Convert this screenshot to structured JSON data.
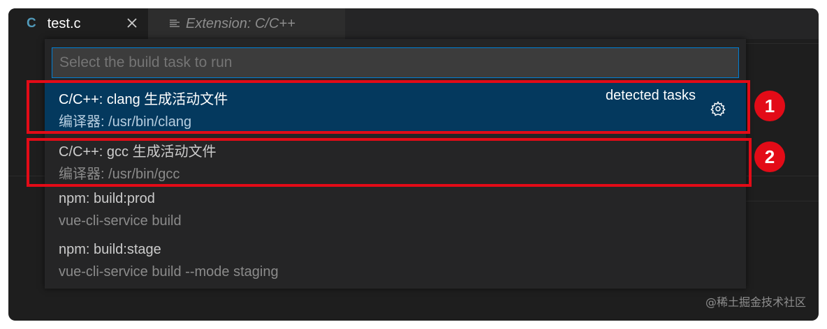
{
  "tabs": {
    "active": {
      "icon": "c-language-icon",
      "icon_text": "C",
      "label": "test.c"
    },
    "inactive": {
      "icon": "preview-icon",
      "label": "Extension: C/C++"
    }
  },
  "quick_pick": {
    "placeholder": "Select the build task to run",
    "items": [
      {
        "label": "C/C++: clang 生成活动文件",
        "detail": "编译器: /usr/bin/clang",
        "group": "detected tasks",
        "selected": true
      },
      {
        "label": "C/C++: gcc 生成活动文件",
        "detail": "编译器: /usr/bin/gcc"
      },
      {
        "label": "npm: build:prod",
        "detail": "vue-cli-service build"
      },
      {
        "label": "npm: build:stage",
        "detail": "vue-cli-service build --mode staging"
      }
    ]
  },
  "annotations": [
    "1",
    "2"
  ],
  "watermark": "@稀土掘金技术社区",
  "colors": {
    "annotation_red": "#e30b17",
    "selected_bg": "#04395e",
    "focus_border": "#007fd4",
    "c_icon": "#519aba"
  }
}
